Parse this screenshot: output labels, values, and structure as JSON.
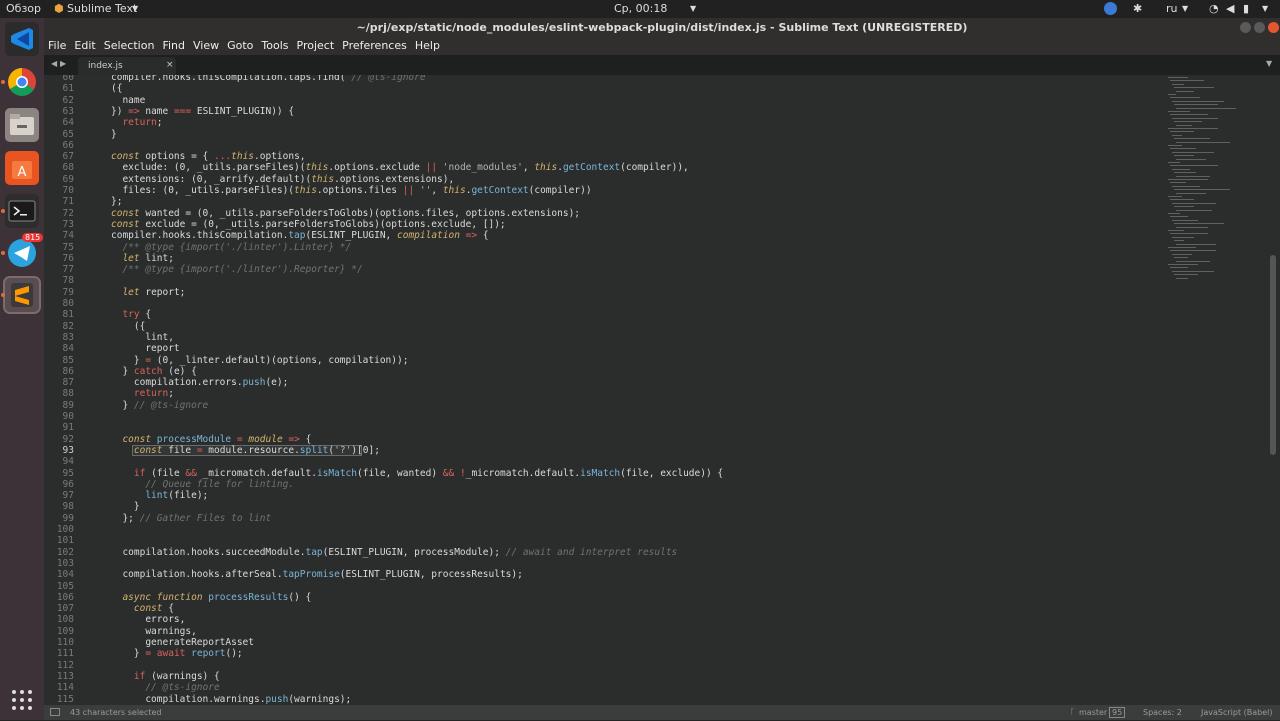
{
  "top_panel": {
    "overview": "Обзор",
    "app_menu": "Sublime Text",
    "clock": "Ср, 00:18",
    "lang": "ru"
  },
  "launcher": {
    "telegram_badge": "815"
  },
  "window": {
    "title": "~/prj/exp/static/node_modules/eslint-webpack-plugin/dist/index.js - Sublime Text (UNREGISTERED)"
  },
  "menu": [
    "File",
    "Edit",
    "Selection",
    "Find",
    "View",
    "Goto",
    "Tools",
    "Project",
    "Preferences",
    "Help"
  ],
  "tab": {
    "label": "index.js"
  },
  "code_lines": [
    {
      "n": "60",
      "segs": [
        [
          "compiler.hooks.thisCompilation.taps.find( ",
          ""
        ],
        [
          "// @ts-ignore",
          "cm"
        ]
      ]
    },
    {
      "n": "61",
      "segs": [
        [
          "({",
          ""
        ]
      ]
    },
    {
      "n": "62",
      "segs": [
        [
          "  name",
          ""
        ]
      ]
    },
    {
      "n": "63",
      "segs": [
        [
          "}) ",
          ""
        ],
        [
          "=>",
          "kw"
        ],
        [
          " name ",
          ""
        ],
        [
          "===",
          "kw"
        ],
        [
          " ESLINT_PLUGIN)) {",
          ""
        ]
      ]
    },
    {
      "n": "64",
      "segs": [
        [
          "  ",
          ""
        ],
        [
          "return",
          "kw"
        ],
        [
          ";",
          ""
        ]
      ]
    },
    {
      "n": "65",
      "segs": [
        [
          "}",
          ""
        ]
      ]
    },
    {
      "n": "66",
      "segs": []
    },
    {
      "n": "67",
      "segs": [
        [
          "const",
          "hl"
        ],
        [
          " options = { ",
          ""
        ],
        [
          "...",
          "kw"
        ],
        [
          "this",
          "hl"
        ],
        [
          ".options,",
          ""
        ]
      ]
    },
    {
      "n": "68",
      "segs": [
        [
          "  exclude: (0, _utils.parseFiles)(",
          ""
        ],
        [
          "this",
          "hl"
        ],
        [
          ".options.exclude ",
          ""
        ],
        [
          "||",
          "kw"
        ],
        [
          " ",
          ""
        ],
        [
          "'node_modules'",
          "st"
        ],
        [
          ", ",
          ""
        ],
        [
          "this",
          "hl"
        ],
        [
          ".",
          ""
        ],
        [
          "getContext",
          "fn"
        ],
        [
          "(compiler)),",
          ""
        ]
      ]
    },
    {
      "n": "69",
      "segs": [
        [
          "  extensions: (0, _arrify.default)(",
          ""
        ],
        [
          "this",
          "hl"
        ],
        [
          ".options.extensions),",
          ""
        ]
      ]
    },
    {
      "n": "70",
      "segs": [
        [
          "  files: (0, _utils.parseFiles)(",
          ""
        ],
        [
          "this",
          "hl"
        ],
        [
          ".options.files ",
          ""
        ],
        [
          "||",
          "kw"
        ],
        [
          " ",
          ""
        ],
        [
          "''",
          "st"
        ],
        [
          ", ",
          ""
        ],
        [
          "this",
          "hl"
        ],
        [
          ".",
          ""
        ],
        [
          "getContext",
          "fn"
        ],
        [
          "(compiler))",
          ""
        ]
      ]
    },
    {
      "n": "71",
      "segs": [
        [
          "};",
          ""
        ]
      ]
    },
    {
      "n": "72",
      "segs": [
        [
          "const",
          "hl"
        ],
        [
          " wanted = (0, _utils.parseFoldersToGlobs)(options.files, options.extensions);",
          ""
        ]
      ]
    },
    {
      "n": "73",
      "segs": [
        [
          "const",
          "hl"
        ],
        [
          " exclude = (0, _utils.parseFoldersToGlobs)(options.exclude, []);",
          ""
        ]
      ]
    },
    {
      "n": "74",
      "segs": [
        [
          "compiler.hooks.thisCompilation.",
          ""
        ],
        [
          "tap",
          "fn"
        ],
        [
          "(ESLINT_PLUGIN, ",
          ""
        ],
        [
          "compilation",
          "hl"
        ],
        [
          " ",
          ""
        ],
        [
          "=>",
          "kw"
        ],
        [
          " {",
          ""
        ]
      ]
    },
    {
      "n": "75",
      "segs": [
        [
          "  ",
          ""
        ],
        [
          "/** @type {import('./linter').Linter} */",
          "cm"
        ]
      ]
    },
    {
      "n": "76",
      "segs": [
        [
          "  ",
          ""
        ],
        [
          "let",
          "hl"
        ],
        [
          " lint;",
          ""
        ]
      ]
    },
    {
      "n": "77",
      "segs": [
        [
          "  ",
          ""
        ],
        [
          "/** @type {import('./linter').Reporter} */",
          "cm"
        ]
      ]
    },
    {
      "n": "78",
      "segs": []
    },
    {
      "n": "79",
      "segs": [
        [
          "  ",
          ""
        ],
        [
          "let",
          "hl"
        ],
        [
          " report;",
          ""
        ]
      ]
    },
    {
      "n": "80",
      "segs": []
    },
    {
      "n": "81",
      "segs": [
        [
          "  ",
          ""
        ],
        [
          "try",
          "kw"
        ],
        [
          " {",
          ""
        ]
      ]
    },
    {
      "n": "82",
      "segs": [
        [
          "    ({",
          ""
        ]
      ]
    },
    {
      "n": "83",
      "segs": [
        [
          "      lint,",
          ""
        ]
      ]
    },
    {
      "n": "84",
      "segs": [
        [
          "      report",
          ""
        ]
      ]
    },
    {
      "n": "85",
      "segs": [
        [
          "    } ",
          ""
        ],
        [
          "=",
          "kw"
        ],
        [
          " (0, _linter.default)(options, compilation));",
          ""
        ]
      ]
    },
    {
      "n": "86",
      "segs": [
        [
          "  } ",
          ""
        ],
        [
          "catch",
          "kw"
        ],
        [
          " (e) {",
          ""
        ]
      ]
    },
    {
      "n": "87",
      "segs": [
        [
          "    compilation.errors.",
          ""
        ],
        [
          "push",
          "fn"
        ],
        [
          "(e);",
          ""
        ]
      ]
    },
    {
      "n": "88",
      "segs": [
        [
          "    ",
          ""
        ],
        [
          "return",
          "kw"
        ],
        [
          ";",
          ""
        ]
      ]
    },
    {
      "n": "89",
      "segs": [
        [
          "  } ",
          ""
        ],
        [
          "// @ts-ignore",
          "cm"
        ]
      ]
    },
    {
      "n": "90",
      "segs": []
    },
    {
      "n": "91",
      "segs": []
    },
    {
      "n": "92",
      "segs": [
        [
          "  ",
          ""
        ],
        [
          "const",
          "hl"
        ],
        [
          " ",
          ""
        ],
        [
          "processModule",
          "fn"
        ],
        [
          " ",
          ""
        ],
        [
          "=",
          "kw"
        ],
        [
          " ",
          ""
        ],
        [
          "module",
          "hl"
        ],
        [
          " ",
          ""
        ],
        [
          "=>",
          "kw"
        ],
        [
          " {",
          ""
        ]
      ]
    },
    {
      "n": "93",
      "segs": [
        [
          "    ",
          ""
        ],
        [
          "const",
          "hl"
        ],
        [
          " file ",
          ""
        ],
        [
          "=",
          "kw"
        ],
        [
          " module.resource.",
          ""
        ],
        [
          "split",
          "fn"
        ],
        [
          "(",
          ""
        ],
        [
          "'?'",
          "st"
        ],
        [
          ")[0];",
          ""
        ]
      ]
    },
    {
      "n": "94",
      "segs": []
    },
    {
      "n": "95",
      "segs": [
        [
          "    ",
          ""
        ],
        [
          "if",
          "kw"
        ],
        [
          " (file ",
          ""
        ],
        [
          "&&",
          "kw"
        ],
        [
          " _micromatch.default.",
          ""
        ],
        [
          "isMatch",
          "fn"
        ],
        [
          "(file, wanted) ",
          ""
        ],
        [
          "&&",
          "kw"
        ],
        [
          " ",
          ""
        ],
        [
          "!",
          "kw"
        ],
        [
          "_micromatch.default.",
          ""
        ],
        [
          "isMatch",
          "fn"
        ],
        [
          "(file, exclude)) {",
          ""
        ]
      ]
    },
    {
      "n": "96",
      "segs": [
        [
          "      ",
          ""
        ],
        [
          "// Queue file for linting.",
          "cm"
        ]
      ]
    },
    {
      "n": "97",
      "segs": [
        [
          "      ",
          ""
        ],
        [
          "lint",
          "fn"
        ],
        [
          "(file);",
          ""
        ]
      ]
    },
    {
      "n": "98",
      "segs": [
        [
          "    }",
          ""
        ]
      ]
    },
    {
      "n": "99",
      "segs": [
        [
          "  }; ",
          ""
        ],
        [
          "// Gather Files to lint",
          "cm"
        ]
      ]
    },
    {
      "n": "100",
      "segs": []
    },
    {
      "n": "101",
      "segs": []
    },
    {
      "n": "102",
      "segs": [
        [
          "  compilation.hooks.succeedModule.",
          ""
        ],
        [
          "tap",
          "fn"
        ],
        [
          "(ESLINT_PLUGIN, processModule); ",
          ""
        ],
        [
          "// await and interpret results",
          "cm"
        ]
      ]
    },
    {
      "n": "103",
      "segs": []
    },
    {
      "n": "104",
      "segs": [
        [
          "  compilation.hooks.afterSeal.",
          ""
        ],
        [
          "tapPromise",
          "fn"
        ],
        [
          "(ESLINT_PLUGIN, processResults);",
          ""
        ]
      ]
    },
    {
      "n": "105",
      "segs": []
    },
    {
      "n": "106",
      "segs": [
        [
          "  ",
          ""
        ],
        [
          "async",
          "hl"
        ],
        [
          " ",
          ""
        ],
        [
          "function",
          "hl"
        ],
        [
          " ",
          ""
        ],
        [
          "processResults",
          "fn"
        ],
        [
          "() {",
          ""
        ]
      ]
    },
    {
      "n": "107",
      "segs": [
        [
          "    ",
          ""
        ],
        [
          "const",
          "hl"
        ],
        [
          " {",
          ""
        ]
      ]
    },
    {
      "n": "108",
      "segs": [
        [
          "      errors,",
          ""
        ]
      ]
    },
    {
      "n": "109",
      "segs": [
        [
          "      warnings,",
          ""
        ]
      ]
    },
    {
      "n": "110",
      "segs": [
        [
          "      generateReportAsset",
          ""
        ]
      ]
    },
    {
      "n": "111",
      "segs": [
        [
          "    } ",
          ""
        ],
        [
          "=",
          "kw"
        ],
        [
          " ",
          ""
        ],
        [
          "await",
          "kw"
        ],
        [
          " ",
          ""
        ],
        [
          "report",
          "fn"
        ],
        [
          "();",
          ""
        ]
      ]
    },
    {
      "n": "112",
      "segs": []
    },
    {
      "n": "113",
      "segs": [
        [
          "    ",
          ""
        ],
        [
          "if",
          "kw"
        ],
        [
          " (warnings) {",
          ""
        ]
      ]
    },
    {
      "n": "114",
      "segs": [
        [
          "      ",
          ""
        ],
        [
          "// @ts-ignore",
          "cm"
        ]
      ]
    },
    {
      "n": "115",
      "segs": [
        [
          "      compilation.warnings.",
          ""
        ],
        [
          "push",
          "fn"
        ],
        [
          "(warnings);",
          ""
        ]
      ]
    }
  ],
  "status_bar": {
    "selection": "43 characters selected",
    "branch": "master",
    "branch_count": "95",
    "spaces": "Spaces: 2",
    "syntax": "JavaScript (Babel)"
  },
  "colors": {
    "keyword": "#d9625a",
    "function": "#7ab5d6",
    "storage": "#d3b46b",
    "comment": "#6f7374",
    "background": "#2b2d2d"
  }
}
